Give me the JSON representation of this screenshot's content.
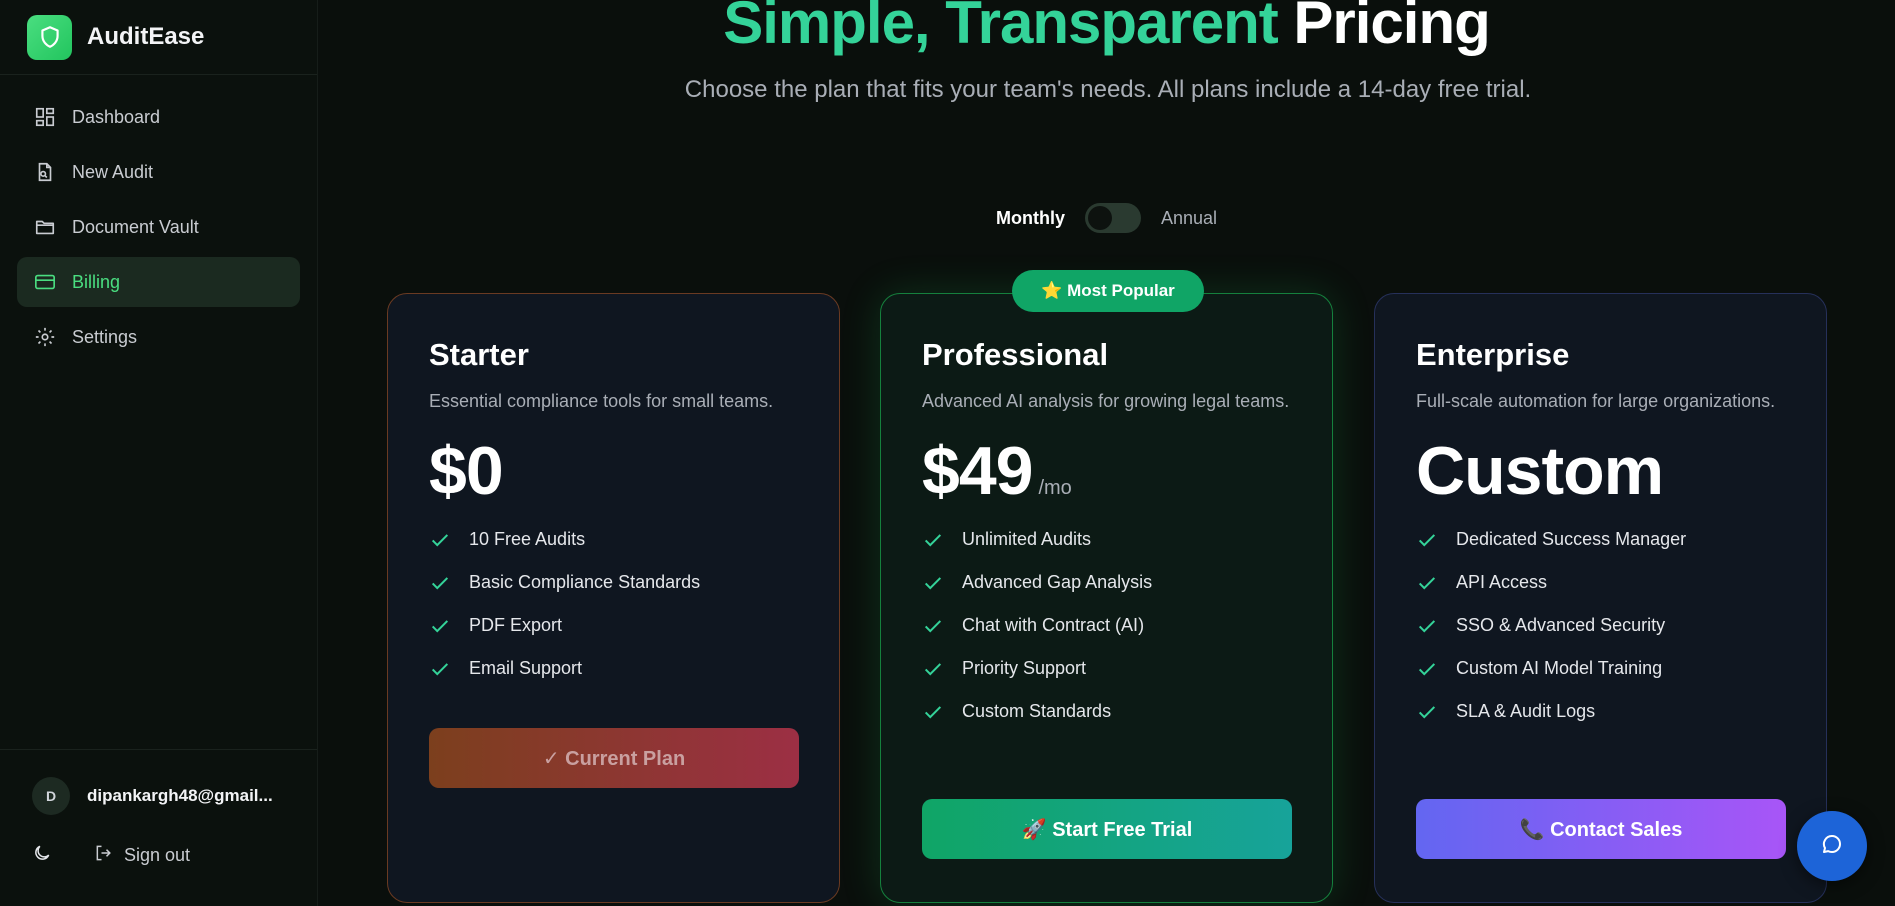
{
  "app": {
    "name": "AuditEase"
  },
  "sidebar": {
    "items": [
      {
        "label": "Dashboard",
        "icon": "dashboard-icon",
        "active": false
      },
      {
        "label": "New Audit",
        "icon": "file-search-icon",
        "active": false
      },
      {
        "label": "Document Vault",
        "icon": "folder-icon",
        "active": false
      },
      {
        "label": "Billing",
        "icon": "credit-card-icon",
        "active": true
      },
      {
        "label": "Settings",
        "icon": "gear-icon",
        "active": false
      }
    ],
    "user": {
      "initial": "D",
      "email": "dipankargh48@gmail..."
    },
    "signout_label": "Sign out"
  },
  "hero": {
    "title_accent": "Simple, Transparent",
    "title_plain": "Pricing",
    "subtitle": "Choose the plan that fits your team's needs. All plans include a 14-day free trial."
  },
  "billing_toggle": {
    "monthly": "Monthly",
    "annual": "Annual",
    "selected": "Monthly"
  },
  "plans": [
    {
      "name": "Starter",
      "description": "Essential compliance tools for small teams.",
      "price": "$0",
      "period": "",
      "features": [
        "10 Free Audits",
        "Basic Compliance Standards",
        "PDF Export",
        "Email Support"
      ],
      "button": "✓ Current Plan"
    },
    {
      "name": "Professional",
      "badge": "⭐ Most Popular",
      "description": "Advanced AI analysis for growing legal teams.",
      "price": "$49",
      "period": "/mo",
      "features": [
        "Unlimited Audits",
        "Advanced Gap Analysis",
        "Chat with Contract (AI)",
        "Priority Support",
        "Custom Standards"
      ],
      "button": "🚀 Start Free Trial"
    },
    {
      "name": "Enterprise",
      "description": "Full-scale automation for large organizations.",
      "price": "Custom",
      "period": "",
      "features": [
        "Dedicated Success Manager",
        "API Access",
        "SSO & Advanced Security",
        "Custom AI Model Training",
        "SLA & Audit Logs"
      ],
      "button": "📞 Contact Sales"
    }
  ],
  "colors": {
    "accent_green": "#34d399",
    "check_green": "#34d399",
    "chat_button": "#1d64d8"
  }
}
